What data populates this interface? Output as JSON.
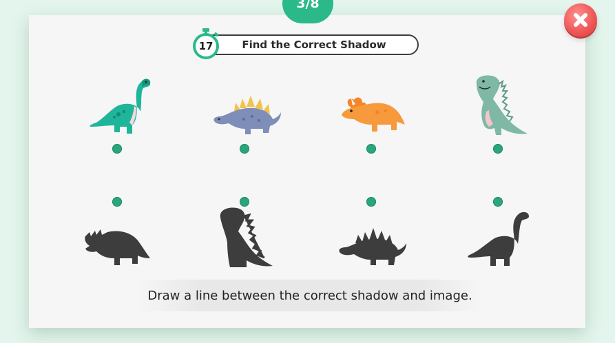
{
  "progress": {
    "text": "3/8",
    "current": 3,
    "total": 8
  },
  "title": "Find the Correct Shadow",
  "timer": {
    "value": "17"
  },
  "instruction": "Draw a line between the correct shadow and image.",
  "colors": {
    "accent": "#2bb98a",
    "close": "#ee5555",
    "background": "#e3f5ec",
    "shadow": "#3d3d3d"
  },
  "top_row": [
    {
      "icon": "brachiosaurus-icon"
    },
    {
      "icon": "stegosaurus-icon"
    },
    {
      "icon": "triceratops-icon"
    },
    {
      "icon": "t-rex-icon"
    }
  ],
  "bottom_row": [
    {
      "icon": "triceratops-shadow-icon"
    },
    {
      "icon": "t-rex-shadow-icon"
    },
    {
      "icon": "stegosaurus-shadow-icon"
    },
    {
      "icon": "brachiosaurus-shadow-icon"
    }
  ]
}
